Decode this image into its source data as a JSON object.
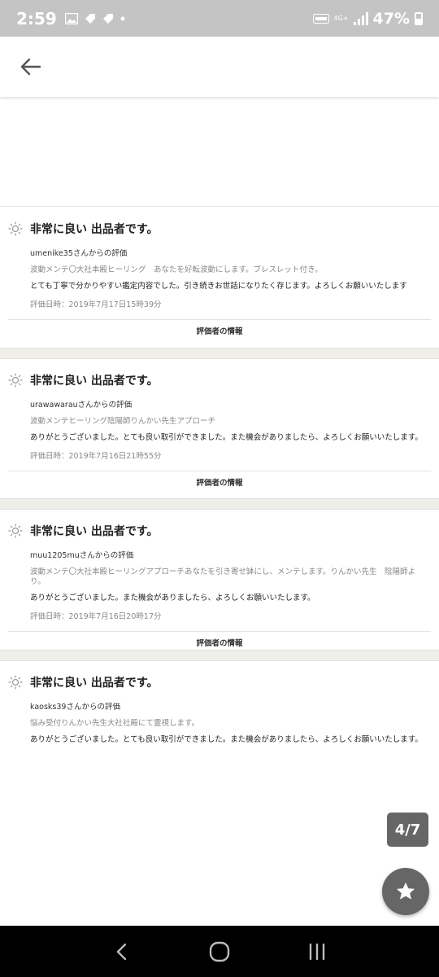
{
  "status_bar": {
    "time": "2:59",
    "network": "4G+",
    "battery": "47%"
  },
  "app_bar": {
    "back_icon": "arrow-left-icon"
  },
  "reviews": [
    {
      "rating": "非常に良い 出品者です。",
      "reviewer": "umenike35さんからの評価",
      "item": "波動メンテ〇大社本殿ヒーリング　あなたを好転波動にします。ブレスレット付き。",
      "comment": "とても丁寧で分かりやすい鑑定内容でした。引き続きお世話になりたく存じます。よろしくお願いいたします",
      "date": "評価日時：2019年7月17日15時39分",
      "info_label": "評価者の情報"
    },
    {
      "rating": "非常に良い 出品者です。",
      "reviewer": "urawawarauさんからの評価",
      "item": "波動メンテヒーリング陰陽師りんかい先生アプローチ",
      "comment": "ありがとうございました。とても良い取引ができました。また機会がありましたら、よろしくお願いいたします。",
      "date": "評価日時：2019年7月16日21時55分",
      "info_label": "評価者の情報"
    },
    {
      "rating": "非常に良い 出品者です。",
      "reviewer": "muu1205muさんからの評価",
      "item": "波動メンテ〇大社本殿ヒーリングアプローチあなたを引き寄せ缽にし、メンテします。りんかい先生　陰陽師より。",
      "comment": "ありがとうございました。また機会がありましたら、よろしくお願いいたします。",
      "date": "評価日時：2019年7月16日20時17分",
      "info_label": "評価者の情報"
    },
    {
      "rating": "非常に良い 出品者です。",
      "reviewer": "kaosks39さんからの評価",
      "item": "悩み受付りんかい先生大社社殿にて霊視します。",
      "comment": "ありがとうございました。とても良い取引ができました。また機会がありましたら、よろしくお願いいたします。"
    }
  ],
  "page_indicator": "4/7",
  "fab_icon": "star-icon",
  "colors": {
    "status_bar": "#c4c4c4",
    "separator": "#efeee9",
    "fab": "#666666"
  }
}
